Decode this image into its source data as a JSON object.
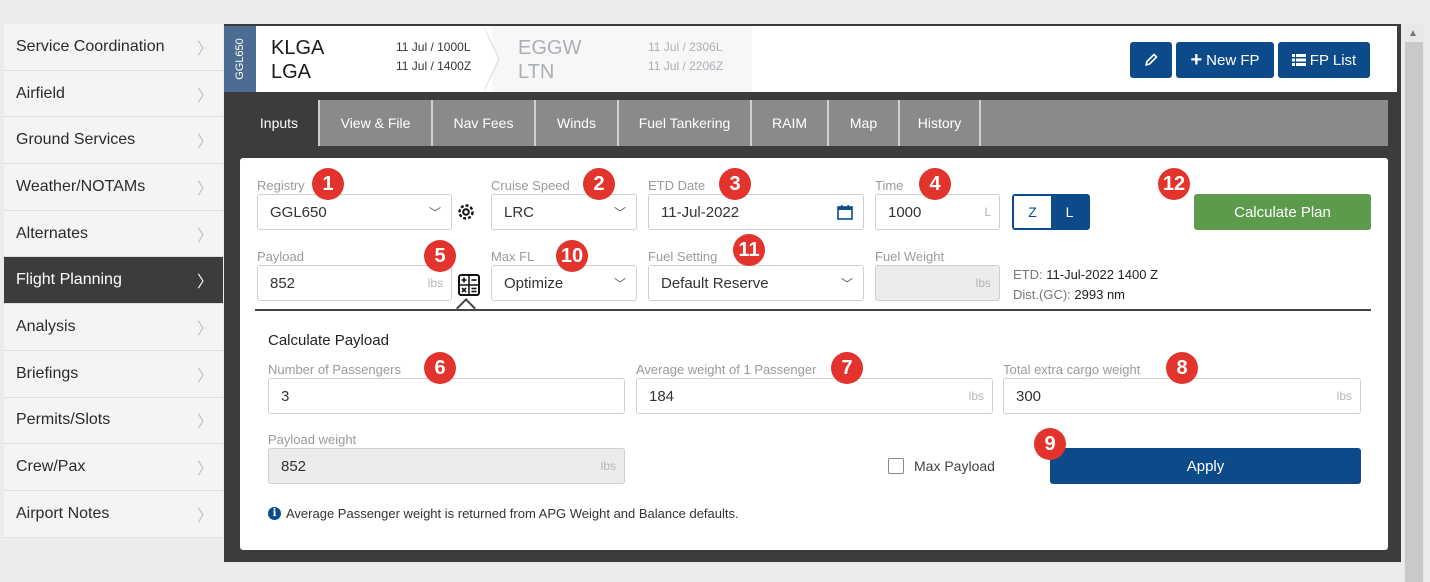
{
  "sidebar": {
    "items": [
      {
        "label": "Service Coordination"
      },
      {
        "label": "Airfield"
      },
      {
        "label": "Ground Services"
      },
      {
        "label": "Weather/NOTAMs"
      },
      {
        "label": "Alternates"
      },
      {
        "label": "Flight Planning",
        "active": true
      },
      {
        "label": "Analysis"
      },
      {
        "label": "Briefings"
      },
      {
        "label": "Permits/Slots"
      },
      {
        "label": "Crew/Pax"
      },
      {
        "label": "Airport Notes"
      }
    ]
  },
  "header": {
    "aircraft": "GGL650",
    "departure": {
      "icao": "KLGA",
      "iata": "LGA",
      "time_local": "11 Jul / 1000L",
      "time_zulu": "11 Jul / 1400Z"
    },
    "arrival": {
      "icao": "EGGW",
      "iata": "LTN",
      "time_local": "11 Jul / 2306L",
      "time_zulu": "11 Jul / 2206Z"
    },
    "buttons": {
      "edit_icon": "pencil-icon",
      "new_fp": "New FP",
      "fp_list": "FP List"
    }
  },
  "tabs": [
    "Inputs",
    "View & File",
    "Nav Fees",
    "Winds",
    "Fuel Tankering",
    "RAIM",
    "Map",
    "History"
  ],
  "form": {
    "registry": {
      "label": "Registry",
      "value": "GGL650"
    },
    "cruise_speed": {
      "label": "Cruise Speed",
      "value": "LRC"
    },
    "etd_date": {
      "label": "ETD Date",
      "value": "11-Jul-2022"
    },
    "time": {
      "label": "Time",
      "value": "1000",
      "suffix": "L"
    },
    "zl_toggle": {
      "z": "Z",
      "l": "L",
      "selected": "L"
    },
    "calculate_plan": "Calculate Plan",
    "payload": {
      "label": "Payload",
      "value": "852",
      "unit": "lbs"
    },
    "max_fl": {
      "label": "Max FL",
      "value": "Optimize"
    },
    "fuel_setting": {
      "label": "Fuel Setting",
      "value": "Default Reserve"
    },
    "fuel_weight": {
      "label": "Fuel Weight",
      "value": "",
      "unit": "lbs"
    },
    "etd_info": {
      "label": "ETD:",
      "value": "11-Jul-2022 1400 Z"
    },
    "dist_info": {
      "label": "Dist.(GC):",
      "value": "2993 nm"
    }
  },
  "calc_payload": {
    "title": "Calculate Payload",
    "passengers": {
      "label": "Number of Passengers",
      "value": "3"
    },
    "avg_weight": {
      "label": "Average weight of 1 Passenger",
      "value": "184",
      "unit": "lbs"
    },
    "extra_cargo": {
      "label": "Total extra cargo weight",
      "value": "300",
      "unit": "lbs"
    },
    "payload_weight": {
      "label": "Payload weight",
      "value": "852",
      "unit": "lbs"
    },
    "max_payload": "Max Payload",
    "apply": "Apply",
    "note": "Average Passenger weight is returned from APG Weight and Balance defaults."
  },
  "badges": [
    "1",
    "2",
    "3",
    "4",
    "5",
    "6",
    "7",
    "8",
    "9",
    "10",
    "11",
    "12"
  ],
  "colors": {
    "primary": "#0c4a8a",
    "success": "#5c9a4c",
    "badge": "#e2332c",
    "dark": "#3c3c3c"
  }
}
